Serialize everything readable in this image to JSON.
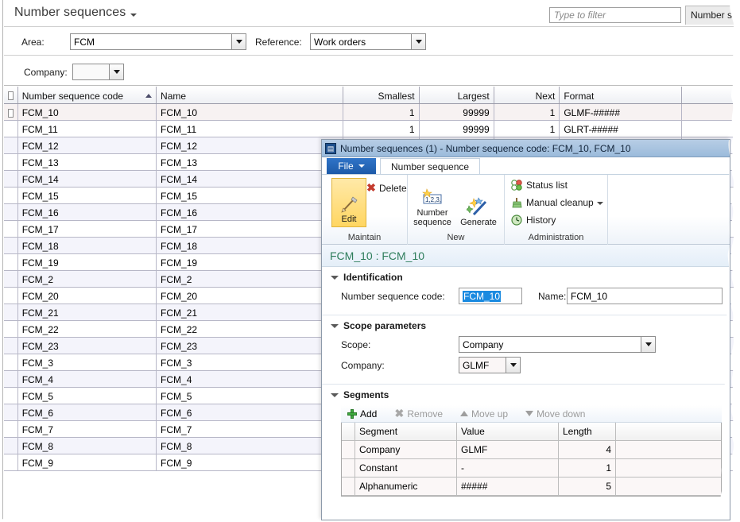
{
  "page": {
    "title": "Number sequences",
    "dropdown_icon": "chevron-down-icon"
  },
  "search": {
    "placeholder": "Type to filter",
    "value": "",
    "scope_button_label": "Number s"
  },
  "filters": {
    "area_label": "Area:",
    "area_value": "FCM",
    "reference_label": "Reference:",
    "reference_value": "Work orders",
    "company_label": "Company:",
    "company_value": ""
  },
  "grid": {
    "columns": [
      {
        "key": "code",
        "label": "Number sequence code",
        "sorted": true,
        "sort_dir": "asc"
      },
      {
        "key": "name",
        "label": "Name"
      },
      {
        "key": "smallest",
        "label": "Smallest",
        "align": "right"
      },
      {
        "key": "largest",
        "label": "Largest",
        "align": "right"
      },
      {
        "key": "next",
        "label": "Next",
        "align": "right"
      },
      {
        "key": "format",
        "label": "Format"
      }
    ],
    "rows": [
      {
        "code": "FCM_10",
        "name": "FCM_10",
        "smallest": "1",
        "largest": "99999",
        "next": "1",
        "format": "GLMF-#####",
        "selected": true
      },
      {
        "code": "FCM_11",
        "name": "FCM_11",
        "smallest": "1",
        "largest": "99999",
        "next": "1",
        "format": "GLRT-#####"
      },
      {
        "code": "FCM_12",
        "name": "FCM_12",
        "smallest": "",
        "largest": "",
        "next": "",
        "format": ""
      },
      {
        "code": "FCM_13",
        "name": "FCM_13",
        "smallest": "",
        "largest": "",
        "next": "",
        "format": ""
      },
      {
        "code": "FCM_14",
        "name": "FCM_14",
        "smallest": "",
        "largest": "",
        "next": "",
        "format": ""
      },
      {
        "code": "FCM_15",
        "name": "FCM_15",
        "smallest": "",
        "largest": "",
        "next": "",
        "format": ""
      },
      {
        "code": "FCM_16",
        "name": "FCM_16",
        "smallest": "",
        "largest": "",
        "next": "",
        "format": ""
      },
      {
        "code": "FCM_17",
        "name": "FCM_17",
        "smallest": "",
        "largest": "",
        "next": "",
        "format": ""
      },
      {
        "code": "FCM_18",
        "name": "FCM_18",
        "smallest": "",
        "largest": "",
        "next": "",
        "format": ""
      },
      {
        "code": "FCM_19",
        "name": "FCM_19",
        "smallest": "",
        "largest": "",
        "next": "",
        "format": ""
      },
      {
        "code": "FCM_2",
        "name": "FCM_2",
        "smallest": "",
        "largest": "",
        "next": "",
        "format": ""
      },
      {
        "code": "FCM_20",
        "name": "FCM_20",
        "smallest": "",
        "largest": "",
        "next": "",
        "format": ""
      },
      {
        "code": "FCM_21",
        "name": "FCM_21",
        "smallest": "",
        "largest": "",
        "next": "",
        "format": ""
      },
      {
        "code": "FCM_22",
        "name": "FCM_22",
        "smallest": "",
        "largest": "",
        "next": "",
        "format": ""
      },
      {
        "code": "FCM_23",
        "name": "FCM_23",
        "smallest": "",
        "largest": "",
        "next": "",
        "format": ""
      },
      {
        "code": "FCM_3",
        "name": "FCM_3",
        "smallest": "",
        "largest": "",
        "next": "",
        "format": ""
      },
      {
        "code": "FCM_4",
        "name": "FCM_4",
        "smallest": "",
        "largest": "",
        "next": "",
        "format": ""
      },
      {
        "code": "FCM_5",
        "name": "FCM_5",
        "smallest": "",
        "largest": "",
        "next": "",
        "format": ""
      },
      {
        "code": "FCM_6",
        "name": "FCM_6",
        "smallest": "",
        "largest": "",
        "next": "",
        "format": ""
      },
      {
        "code": "FCM_7",
        "name": "FCM_7",
        "smallest": "",
        "largest": "",
        "next": "",
        "format": ""
      },
      {
        "code": "FCM_8",
        "name": "FCM_8",
        "smallest": "",
        "largest": "",
        "next": "",
        "format": ""
      },
      {
        "code": "FCM_9",
        "name": "FCM_9",
        "smallest": "",
        "largest": "",
        "next": "",
        "format": ""
      }
    ]
  },
  "dialog": {
    "icon": "app-window-icon",
    "title": "Number sequences (1) - Number sequence code: FCM_10, FCM_10",
    "ribbon": {
      "file_tab": "File",
      "tabs": [
        {
          "label": "Number sequence",
          "active": true
        }
      ],
      "groups": [
        {
          "name": "Maintain",
          "label": "Maintain",
          "buttons": [
            {
              "label": "Edit",
              "style": "big",
              "icon": "pencil-icon",
              "highlighted": true
            },
            {
              "label": "Delete",
              "style": "small",
              "icon": "red-x-icon"
            }
          ]
        },
        {
          "name": "New",
          "label": "New",
          "buttons": [
            {
              "label": "Number sequence",
              "style": "big",
              "icon": "numbers-123-icon"
            },
            {
              "label": "Generate",
              "style": "big",
              "icon": "magic-wand-icon"
            }
          ]
        },
        {
          "name": "Administration",
          "label": "Administration",
          "buttons": [
            {
              "label": "Status list",
              "style": "small",
              "icon": "status-list-icon"
            },
            {
              "label": "Manual cleanup",
              "style": "small",
              "icon": "broom-icon",
              "has_menu": true
            },
            {
              "label": "History",
              "style": "small",
              "icon": "clock-history-icon"
            }
          ]
        }
      ]
    },
    "record_caption": "FCM_10 : FCM_10",
    "sections": [
      {
        "id": "identification",
        "title": "Identification",
        "expanded": true,
        "fields": [
          {
            "label": "Number sequence code:",
            "value": "FCM_10",
            "selected": true
          },
          {
            "label": "Name:",
            "value": "FCM_10",
            "selected": false
          }
        ]
      },
      {
        "id": "scope_parameters",
        "title": "Scope parameters",
        "expanded": true,
        "fields": [
          {
            "label": "Scope:",
            "value": "Company",
            "control": "combo"
          },
          {
            "label": "Company:",
            "value": "GLMF",
            "control": "combo"
          }
        ]
      },
      {
        "id": "segments",
        "title": "Segments",
        "expanded": true
      }
    ],
    "segments": {
      "toolbar": [
        {
          "label": "Add",
          "icon": "plus-icon",
          "enabled": true
        },
        {
          "label": "Remove",
          "icon": "x-icon",
          "enabled": false
        },
        {
          "label": "Move up",
          "icon": "arrow-up-icon",
          "enabled": false
        },
        {
          "label": "Move down",
          "icon": "arrow-down-icon",
          "enabled": false
        }
      ],
      "columns": [
        {
          "key": "segment",
          "label": "Segment"
        },
        {
          "key": "value",
          "label": "Value"
        },
        {
          "key": "length",
          "label": "Length",
          "align": "right"
        }
      ],
      "rows": [
        {
          "segment": "Company",
          "value": "GLMF",
          "length": "4"
        },
        {
          "segment": "Constant",
          "value": "-",
          "length": "1"
        },
        {
          "segment": "Alphanumeric",
          "value": "#####",
          "length": "5"
        }
      ]
    }
  },
  "colors": {
    "title_bar": "#9bbbdb",
    "file_tab": "#1d5aa8",
    "record_caption_text": "#2e7d5b",
    "highlight_button": "#ffd662",
    "selection": "#1a8ae0",
    "row_alt": "#f4f4fb"
  }
}
